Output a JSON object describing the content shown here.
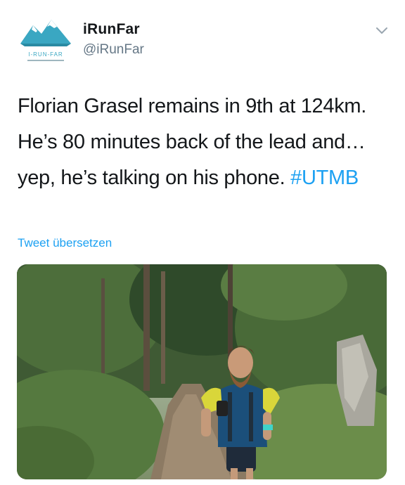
{
  "account": {
    "display_name": "iRunFar",
    "handle": "@iRunFar",
    "logo_text": "I-RUN-FAR",
    "logo_tagline": "THE ADVENTURE..."
  },
  "tweet": {
    "text": "Florian Grasel remains in 9th at 124km. He’s 80 minutes back of the lead and… yep, he’s talking on his phone.",
    "hashtag": "#UTMB",
    "translate_label": "Tweet übersetzen"
  },
  "icons": {
    "menu": "chevron-down-icon"
  },
  "colors": {
    "link": "#1da1f2",
    "text": "#14171a",
    "secondary": "#657786",
    "logo_teal": "#2f9fb8"
  },
  "photo": {
    "subject": "trail-runner-on-forest-path"
  }
}
